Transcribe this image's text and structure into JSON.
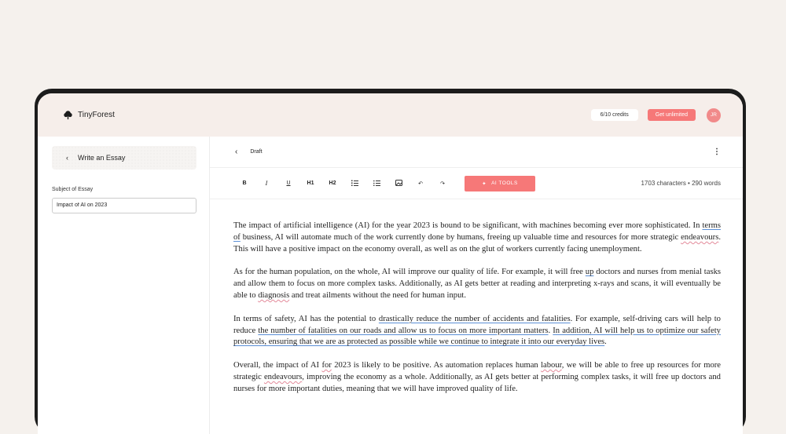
{
  "header": {
    "brand": "TinyForest",
    "credits": "6/10 credits",
    "upgrade": "Get unlimited",
    "avatar": "JR"
  },
  "sidebar": {
    "back_label": "Write an Essay",
    "field_label": "Subject of Essay",
    "field_value": "Impact of AI on 2023"
  },
  "document": {
    "status": "Draft"
  },
  "toolbar": {
    "bold": "B",
    "italic": "I",
    "underline": "U",
    "h1": "H1",
    "h2": "H2",
    "ai_tools": "AI TOOLS",
    "counts": "1703 characters • 290 words"
  },
  "editor": {
    "p1": [
      {
        "t": "The impact of artificial intelligence (AI) for the year 2023 is bound to be significant, with machines becoming ever more sophisticated. In "
      },
      {
        "t": "terms of",
        "m": "gr"
      },
      {
        "t": " business, AI will automate much of the work currently done by humans, freeing up valuable time and resources for more strategic "
      },
      {
        "t": "endeavours",
        "m": "sp"
      },
      {
        "t": ". This will have a positive impact on the economy overall, as well as on the glut of workers currently facing unemployment."
      }
    ],
    "p2": [
      {
        "t": "As for the human population, on the whole, AI will improve our quality of life. For example, it will free "
      },
      {
        "t": "up",
        "m": "gr"
      },
      {
        "t": " doctors and nurses from menial tasks and allow them to focus on more complex tasks. Additionally, as AI gets better at reading and interpreting x-rays and scans, it will eventually be able to "
      },
      {
        "t": "diagnosis",
        "m": "sp"
      },
      {
        "t": " and treat ailments without the need for human input."
      }
    ],
    "p3": [
      {
        "t": "In terms of safety, AI has the potential to "
      },
      {
        "t": "drastically reduce the number of accidents and fatalities",
        "m": "gr"
      },
      {
        "t": ". For example, self-driving cars will help to reduce "
      },
      {
        "t": "the number of fatalities on our roads and allow us to focus on more important matters",
        "m": "gr"
      },
      {
        "t": ". "
      },
      {
        "t": "In addition, AI will help us to optimize our safety protocols, ensuring that we are as protected as possible while we continue to integrate it into our everyday lives",
        "m": "gr"
      },
      {
        "t": "."
      }
    ],
    "p4": [
      {
        "t": "Overall, the impact of AI "
      },
      {
        "t": "for",
        "m": "sp"
      },
      {
        "t": " 2023 is likely to be positive. As automation replaces human "
      },
      {
        "t": "labour",
        "m": "sp"
      },
      {
        "t": ", we will be able to free up resources for more strategic "
      },
      {
        "t": "endeavours",
        "m": "sp"
      },
      {
        "t": ", improving the economy as a whole. Additionally, as AI gets better at performing complex tasks, it will free up doctors and nurses for more important duties, meaning that we will have improved quality of life."
      }
    ]
  }
}
